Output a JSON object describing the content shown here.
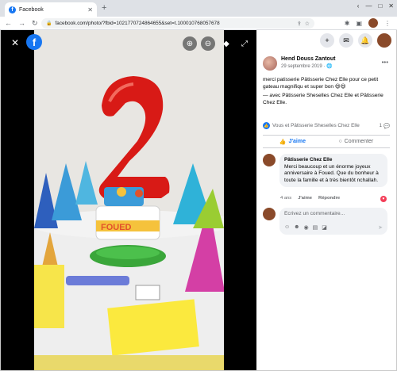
{
  "browser": {
    "tab_title": "Facebook",
    "tab_favicon": "f",
    "close_tab": "✕",
    "new_tab": "+",
    "url": "facebook.com/photo/?fbid=1021770724864655&set=t.100010768057678",
    "window_controls": [
      "‹",
      "—",
      "□",
      "✕"
    ]
  },
  "viewer": {
    "close": "✕",
    "logo": "f",
    "zoom_in_icon": "zoom-in-icon",
    "zoom_out_icon": "zoom-out-icon",
    "tag_icon": "tag-icon",
    "fullscreen_icon": "fullscreen-icon",
    "colors": {
      "balloon": "#d81a16",
      "cake_base": "#3aa63a",
      "hat_blue": "#3b9bd8"
    }
  },
  "post": {
    "author": "Hend Douss Zantout",
    "date": "29 septembre 2019 · ",
    "text_1": "merci patisserie ",
    "text_link_1": "Pâtisserie Chez Elle",
    "text_2": " pour ce petit gateau magnifiqu et super bon 😄😄",
    "with_prefix": "— avec ",
    "with_link_1": "Pâtisserie Sheselles Chez Elle",
    "with_mid": " et ",
    "with_link_2": "Pâtisserie Chez Elle",
    "with_end": ".",
    "reactions_text": "Vous et Pâtisserie Sheselles Chez Elle",
    "comment_count": "1",
    "like_label": "J'aime",
    "comment_label": "Commenter"
  },
  "comment": {
    "name": "Pâtisserie Chez Elle",
    "text": "Merci beaucoup et un énorme joyeux anniversaire à Foued. Que du bonheur à toute la famille et à très bientôt nchallah.",
    "age": "4 ans",
    "like": "J'aime",
    "reply": "Répondre"
  },
  "write": {
    "placeholder": "Écrivez un commentaire..."
  }
}
